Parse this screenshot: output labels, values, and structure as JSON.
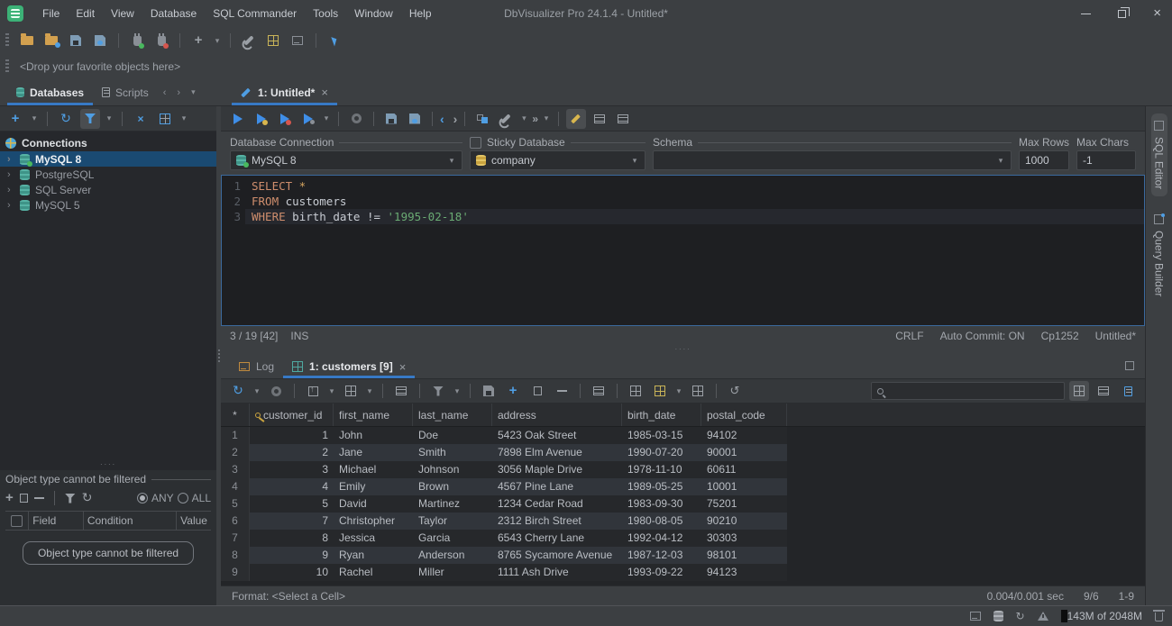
{
  "titlebar": {
    "title": "DbVisualizer Pro 24.1.4 - Untitled*",
    "menus": [
      "File",
      "Edit",
      "View",
      "Database",
      "SQL Commander",
      "Tools",
      "Window",
      "Help"
    ]
  },
  "favorites": {
    "hint": "<Drop your favorite objects here>"
  },
  "panel_tabs": {
    "databases": "Databases",
    "scripts": "Scripts"
  },
  "editor_tab": {
    "label": "1: Untitled*",
    "close": "×"
  },
  "sidebar": {
    "root_label": "Connections",
    "connections": [
      {
        "label": "MySQL 8",
        "selected": true
      },
      {
        "label": "PostgreSQL",
        "selected": false
      },
      {
        "label": "SQL Server",
        "selected": false
      },
      {
        "label": "MySQL 5",
        "selected": false
      }
    ],
    "filter": {
      "title": "Object type cannot be filtered",
      "any": "ANY",
      "all": "ALL",
      "columns": [
        "Field",
        "Condition",
        "Value"
      ],
      "empty_button": "Object type cannot be filtered"
    }
  },
  "connection_bar": {
    "labels": {
      "connection": "Database Connection",
      "sticky": "Sticky Database",
      "schema": "Schema",
      "max_rows": "Max Rows",
      "max_chars": "Max Chars"
    },
    "values": {
      "connection": "MySQL 8",
      "database": "company",
      "schema": "",
      "max_rows": "1000",
      "max_chars": "-1"
    }
  },
  "editor": {
    "lines": [
      {
        "num": "1",
        "current": false,
        "tokens": [
          [
            "kw",
            "SELECT"
          ],
          [
            "op",
            " *"
          ]
        ]
      },
      {
        "num": "2",
        "current": false,
        "tokens": [
          [
            "kw",
            "FROM"
          ],
          [
            "pl",
            " customers"
          ]
        ]
      },
      {
        "num": "3",
        "current": true,
        "tokens": [
          [
            "kw",
            "WHERE"
          ],
          [
            "pl",
            " birth_date != "
          ],
          [
            "st",
            "'1995-02-18'"
          ]
        ]
      }
    ],
    "status": {
      "position": "3 / 19  [42]",
      "mode": "INS",
      "eol": "CRLF",
      "autocommit": "Auto Commit: ON",
      "encoding": "Cp1252",
      "doc": "Untitled*"
    }
  },
  "results": {
    "log_tab": "Log",
    "grid_tab": "1: customers [9]",
    "grid_tab_close": "×"
  },
  "table": {
    "columns": [
      "*",
      "customer_id",
      "first_name",
      "last_name",
      "address",
      "birth_date",
      "postal_code"
    ],
    "rows": [
      [
        "1",
        "1",
        "John",
        "Doe",
        "5423 Oak Street",
        "1985-03-15",
        "94102"
      ],
      [
        "2",
        "2",
        "Jane",
        "Smith",
        "7898 Elm Avenue",
        "1990-07-20",
        "90001"
      ],
      [
        "3",
        "3",
        "Michael",
        "Johnson",
        "3056 Maple Drive",
        "1978-11-10",
        "60611"
      ],
      [
        "4",
        "4",
        "Emily",
        "Brown",
        "4567 Pine Lane",
        "1989-05-25",
        "10001"
      ],
      [
        "5",
        "5",
        "David",
        "Martinez",
        "1234 Cedar Road",
        "1983-09-30",
        "75201"
      ],
      [
        "6",
        "7",
        "Christopher",
        "Taylor",
        "2312 Birch Street",
        "1980-08-05",
        "90210"
      ],
      [
        "7",
        "8",
        "Jessica",
        "Garcia",
        "6543 Cherry Lane",
        "1992-04-12",
        "30303"
      ],
      [
        "8",
        "9",
        "Ryan",
        "Anderson",
        "8765 Sycamore Avenue",
        "1987-12-03",
        "98101"
      ],
      [
        "9",
        "10",
        "Rachel",
        "Miller",
        "1111 Ash Drive",
        "1993-09-22",
        "94123"
      ]
    ]
  },
  "grid_status": {
    "format": "Format: <Select a Cell>",
    "timing": "0.004/0.001 sec",
    "cells": "9/6",
    "range": "1-9"
  },
  "right_tabs": [
    {
      "label": "SQL Editor",
      "active": true
    },
    {
      "label": "Query Builder",
      "active": false
    }
  ],
  "statusbar": {
    "memory": "143M of 2048M"
  }
}
